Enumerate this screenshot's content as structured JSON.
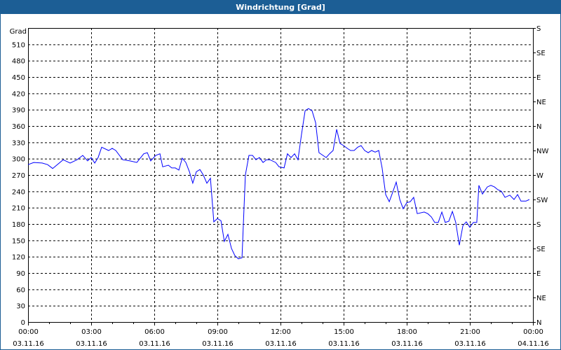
{
  "window": {
    "title": "Windrichtung [Grad]"
  },
  "chart_data": {
    "type": "line",
    "title": "Windrichtung [Grad]",
    "ylabel": "Grad",
    "ylim": [
      0,
      540
    ],
    "yticks": [
      0,
      30,
      60,
      90,
      120,
      150,
      180,
      210,
      240,
      270,
      300,
      330,
      360,
      390,
      420,
      450,
      480,
      510
    ],
    "y2ticks": [
      {
        "value": 0,
        "label": "N"
      },
      {
        "value": 45,
        "label": "NE"
      },
      {
        "value": 90,
        "label": "E"
      },
      {
        "value": 135,
        "label": "SE"
      },
      {
        "value": 180,
        "label": "S"
      },
      {
        "value": 225,
        "label": "SW"
      },
      {
        "value": 270,
        "label": "W"
      },
      {
        "value": 315,
        "label": "NW"
      },
      {
        "value": 360,
        "label": "N"
      },
      {
        "value": 405,
        "label": "NE"
      },
      {
        "value": 450,
        "label": "E"
      },
      {
        "value": 495,
        "label": "SE"
      },
      {
        "value": 540,
        "label": "S"
      }
    ],
    "xlim_hours": [
      0,
      24
    ],
    "xticks": [
      {
        "hour": 0,
        "time": "00:00",
        "date": "03.11.16"
      },
      {
        "hour": 3,
        "time": "03:00",
        "date": "03.11.16"
      },
      {
        "hour": 6,
        "time": "06:00",
        "date": "03.11.16"
      },
      {
        "hour": 9,
        "time": "09:00",
        "date": "03.11.16"
      },
      {
        "hour": 12,
        "time": "12:00",
        "date": "03.11.16"
      },
      {
        "hour": 15,
        "time": "15:00",
        "date": "03.11.16"
      },
      {
        "hour": 18,
        "time": "18:00",
        "date": "03.11.16"
      },
      {
        "hour": 21,
        "time": "21:00",
        "date": "03.11.16"
      },
      {
        "hour": 24,
        "time": "00:00",
        "date": "04.11.16"
      }
    ],
    "grid": true,
    "series": [
      {
        "name": "Windrichtung",
        "color": "#0000ff",
        "x": [
          0,
          0.27,
          0.67,
          0.93,
          1.17,
          1.67,
          2,
          2.33,
          2.6,
          2.83,
          3,
          3.17,
          3.33,
          3.5,
          3.83,
          4,
          4.17,
          4.5,
          4.83,
          5.17,
          5.5,
          5.67,
          5.83,
          6.07,
          6.27,
          6.4,
          6.67,
          6.83,
          7,
          7.17,
          7.33,
          7.5,
          7.67,
          7.83,
          8,
          8.17,
          8.33,
          8.5,
          8.67,
          8.83,
          9,
          9.17,
          9.33,
          9.5,
          9.67,
          9.83,
          10,
          10.17,
          10.33,
          10.5,
          10.67,
          10.83,
          11,
          11.17,
          11.33,
          11.5,
          11.77,
          11.93,
          12.17,
          12.33,
          12.5,
          12.67,
          12.83,
          13,
          13.17,
          13.33,
          13.5,
          13.67,
          13.83,
          14.17,
          14.33,
          14.5,
          14.67,
          14.83,
          15,
          15.17,
          15.33,
          15.5,
          15.67,
          15.83,
          16,
          16.17,
          16.33,
          16.5,
          16.67,
          16.83,
          17,
          17.17,
          17.33,
          17.5,
          17.67,
          17.83,
          18,
          18.17,
          18.33,
          18.5,
          18.83,
          19,
          19.17,
          19.33,
          19.5,
          19.67,
          19.83,
          20,
          20.17,
          20.33,
          20.5,
          20.67,
          20.83,
          21,
          21.17,
          21.33,
          21.43,
          21.6,
          21.83,
          22,
          22.17,
          22.33,
          22.5,
          22.67,
          22.9,
          23.1,
          23.27,
          23.43,
          23.67,
          23.83
        ],
        "values": [
          289,
          293,
          292,
          289,
          282,
          298,
          292,
          298,
          306,
          296,
          302,
          292,
          302,
          321,
          315,
          319,
          315,
          298,
          296,
          293,
          309,
          311,
          296,
          306,
          309,
          285,
          288,
          283,
          283,
          279,
          301,
          293,
          276,
          255,
          276,
          280,
          270,
          255,
          264,
          184,
          190,
          186,
          148,
          161,
          135,
          122,
          116,
          118,
          270,
          306,
          306,
          298,
          302,
          293,
          298,
          298,
          293,
          285,
          283,
          309,
          302,
          309,
          298,
          345,
          388,
          392,
          388,
          366,
          311,
          302,
          309,
          315,
          354,
          328,
          324,
          319,
          315,
          315,
          321,
          324,
          315,
          311,
          315,
          312,
          315,
          283,
          234,
          221,
          238,
          257,
          225,
          208,
          219,
          221,
          229,
          199,
          202,
          199,
          193,
          183,
          183,
          202,
          183,
          185,
          203,
          183,
          141,
          177,
          184,
          174,
          183,
          183,
          251,
          235,
          248,
          251,
          248,
          243,
          240,
          229,
          233,
          225,
          234,
          222,
          222,
          225
        ]
      }
    ]
  }
}
